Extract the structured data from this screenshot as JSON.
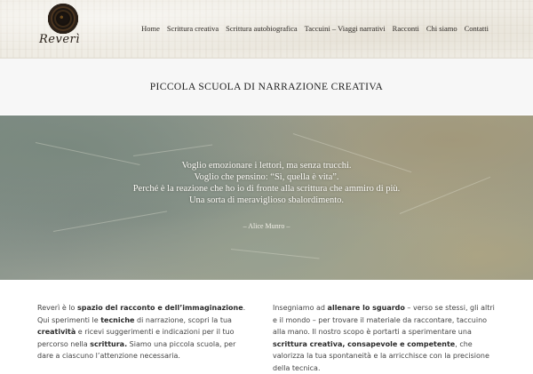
{
  "header": {
    "logo_text": "Reverì",
    "nav": [
      "Home",
      "Scrittura creativa",
      "Scrittura autobiografica",
      "Taccuini – Viaggi narrativi",
      "Racconti",
      "Chi siamo",
      "Contatti"
    ]
  },
  "title": "PICCOLA SCUOLA DI NARRAZIONE CREATIVA",
  "hero": {
    "quote_lines": [
      "Voglio emozionare i lettori, ma senza trucchi.",
      "Voglio che pensino: “Sì, quella è vita”.",
      "Perché è la reazione che ho io di fronte alla scrittura che ammiro di più.",
      "Una sorta di meraviglioso sbalordimento."
    ],
    "author": "– Alice Munro –"
  },
  "left_column": {
    "p1": "Reverì è lo ",
    "b1": "spazio del racconto e dell’immaginazione",
    "p2": ". Qui sperimenti le ",
    "b2": "tecniche",
    "p3": " di narrazione, scopri la tua ",
    "b3": "creatività",
    "p4": " e ricevi suggerimenti e indicazioni per il tuo percorso nella ",
    "b4": "scrittura.",
    "p5": " Siamo una piccola scuola, per dare a ciascuno l’attenzione necessaria."
  },
  "right_column": {
    "p1": "Insegniamo ad ",
    "b1": "allenare lo sguardo",
    "p2": " – verso se stessi, gli altri e il mondo – per  trovare il materiale da raccontare, taccuino alla mano. Il nostro scopo è portarti a sperimentare una ",
    "b2": "scrittura creativa, consapevole e competente",
    "p3": ", che valorizza la tua spontaneità e la arricchisce con la precisione della tecnica."
  }
}
